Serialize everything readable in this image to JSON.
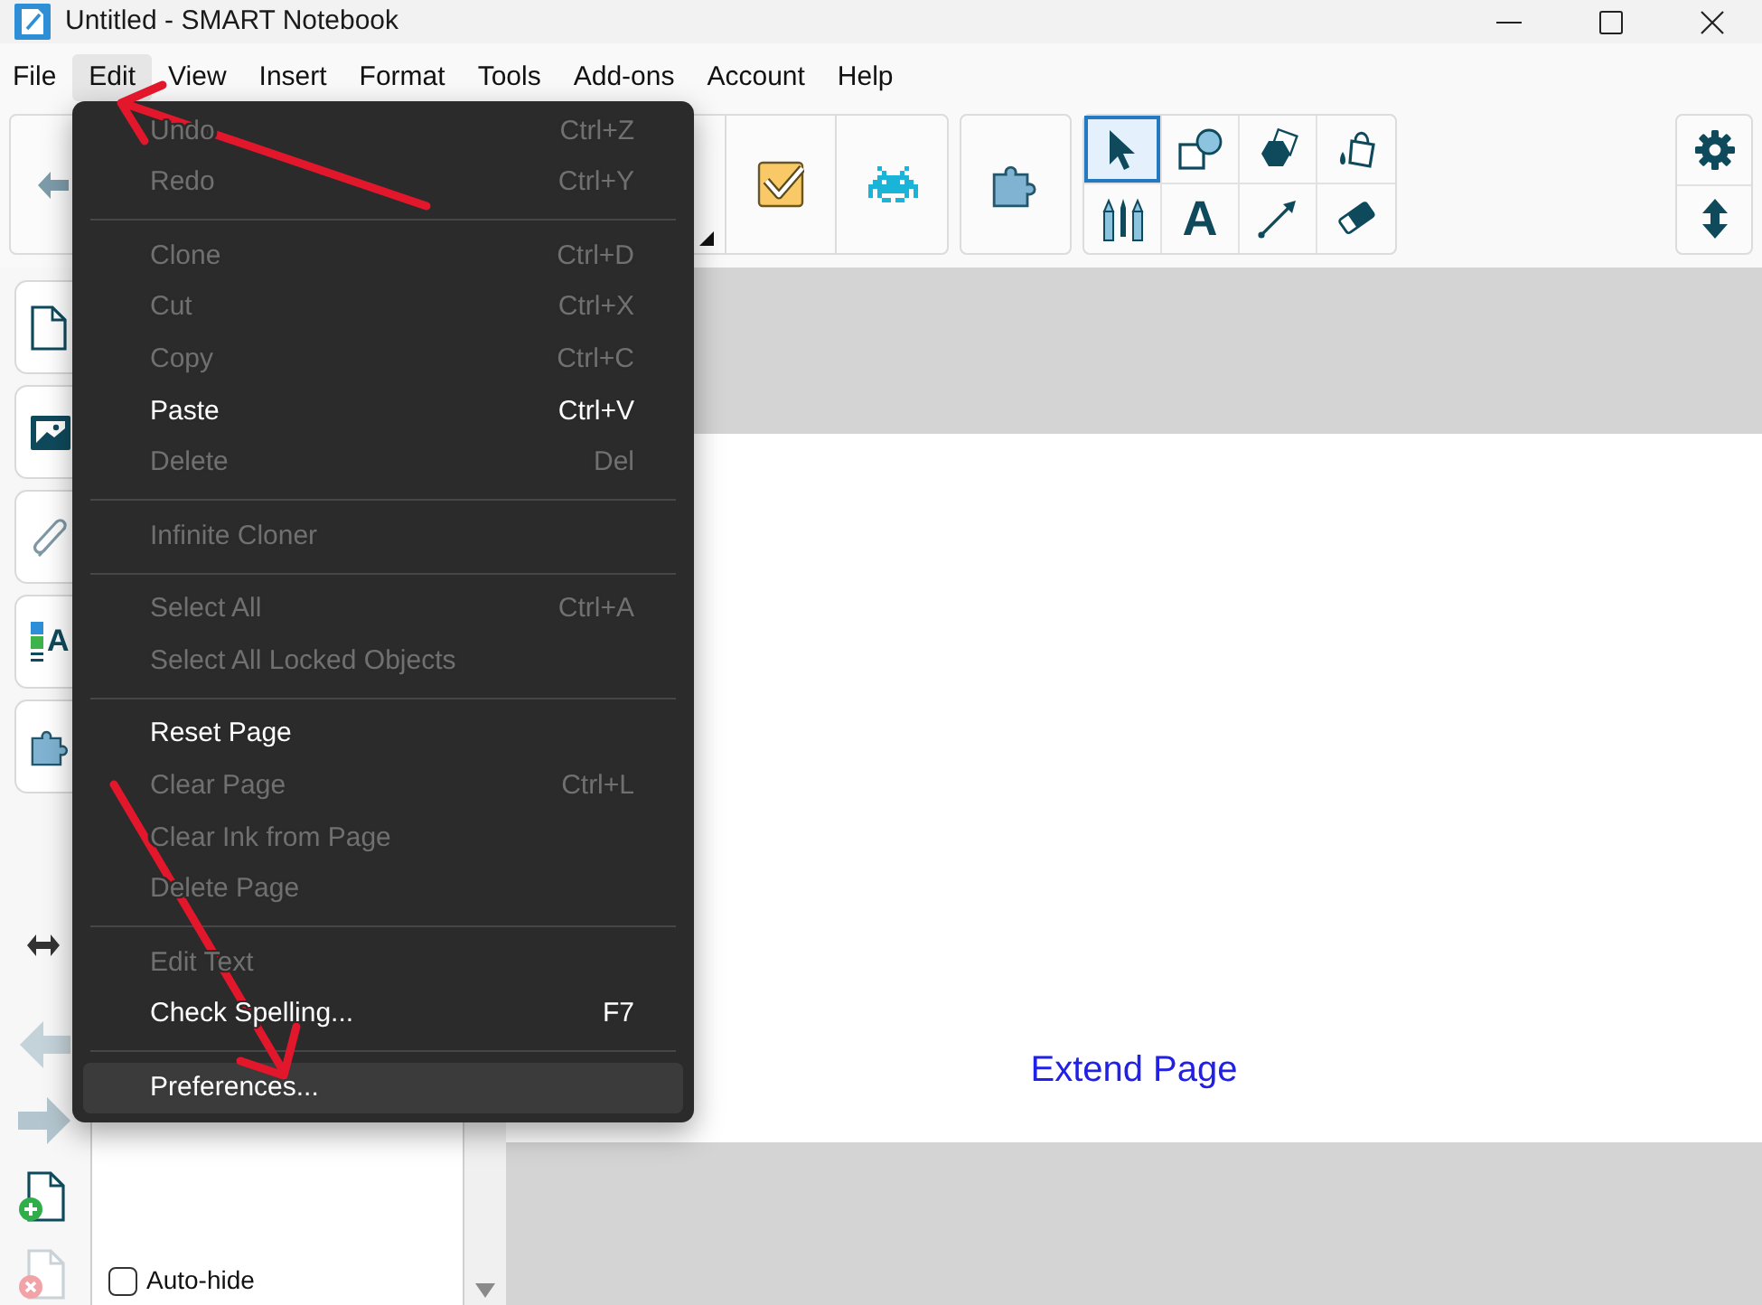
{
  "window": {
    "title": "Untitled - SMART Notebook"
  },
  "menu_bar": [
    {
      "label": "File",
      "selected": false
    },
    {
      "label": "Edit",
      "selected": true
    },
    {
      "label": "View",
      "selected": false
    },
    {
      "label": "Insert",
      "selected": false
    },
    {
      "label": "Format",
      "selected": false
    },
    {
      "label": "Tools",
      "selected": false
    },
    {
      "label": "Add-ons",
      "selected": false
    },
    {
      "label": "Account",
      "selected": false
    },
    {
      "label": "Help",
      "selected": false
    }
  ],
  "toolbar": {
    "tools": [
      {
        "kind": "select",
        "selected": true
      },
      {
        "kind": "shapes",
        "selected": false
      },
      {
        "kind": "polygon",
        "selected": false
      },
      {
        "kind": "fill",
        "selected": false
      },
      {
        "kind": "pens",
        "selected": false
      },
      {
        "kind": "text",
        "glyph": "A",
        "selected": false
      },
      {
        "kind": "line",
        "selected": false
      },
      {
        "kind": "eraser",
        "selected": false
      }
    ]
  },
  "sidebar_tabs": [
    {
      "kind": "pages"
    },
    {
      "kind": "gallery"
    },
    {
      "kind": "attachments"
    },
    {
      "kind": "properties",
      "glyph": "A"
    },
    {
      "kind": "addons"
    }
  ],
  "side_panel": {
    "auto_hide": {
      "label": "Auto-hide",
      "checked": false
    }
  },
  "page": {
    "link": "Extend Page"
  },
  "edit_menu": [
    {
      "kind": "item",
      "label": "Undo",
      "shortcut": "Ctrl+Z",
      "disabled": true,
      "selected": false
    },
    {
      "kind": "item",
      "label": "Redo",
      "shortcut": "Ctrl+Y",
      "disabled": true,
      "selected": false
    },
    {
      "kind": "separator"
    },
    {
      "kind": "item",
      "label": "Clone",
      "shortcut": "Ctrl+D",
      "disabled": true,
      "selected": false
    },
    {
      "kind": "item",
      "label": "Cut",
      "shortcut": "Ctrl+X",
      "disabled": true,
      "selected": false
    },
    {
      "kind": "item",
      "label": "Copy",
      "shortcut": "Ctrl+C",
      "disabled": true,
      "selected": false
    },
    {
      "kind": "item",
      "label": "Paste",
      "shortcut": "Ctrl+V",
      "disabled": false,
      "selected": false
    },
    {
      "kind": "item",
      "label": "Delete",
      "shortcut": "Del",
      "disabled": true,
      "selected": false
    },
    {
      "kind": "separator"
    },
    {
      "kind": "item",
      "label": "Infinite Cloner",
      "disabled": true,
      "selected": false
    },
    {
      "kind": "separator"
    },
    {
      "kind": "item",
      "label": "Select All",
      "shortcut": "Ctrl+A",
      "disabled": true,
      "selected": false
    },
    {
      "kind": "item",
      "label": "Select All Locked Objects",
      "disabled": true,
      "selected": false
    },
    {
      "kind": "separator"
    },
    {
      "kind": "item",
      "label": "Reset Page",
      "disabled": false,
      "selected": false
    },
    {
      "kind": "item",
      "label": "Clear Page",
      "shortcut": "Ctrl+L",
      "disabled": true,
      "selected": false
    },
    {
      "kind": "item",
      "label": "Clear Ink from Page",
      "disabled": true,
      "selected": false
    },
    {
      "kind": "item",
      "label": "Delete Page",
      "disabled": true,
      "selected": false
    },
    {
      "kind": "separator"
    },
    {
      "kind": "item",
      "label": "Edit Text",
      "disabled": true,
      "selected": false
    },
    {
      "kind": "item",
      "label": "Check Spelling...",
      "shortcut": "F7",
      "disabled": false,
      "selected": false
    },
    {
      "kind": "separator"
    },
    {
      "kind": "item",
      "label": "Preferences...",
      "disabled": false,
      "selected": true
    }
  ]
}
